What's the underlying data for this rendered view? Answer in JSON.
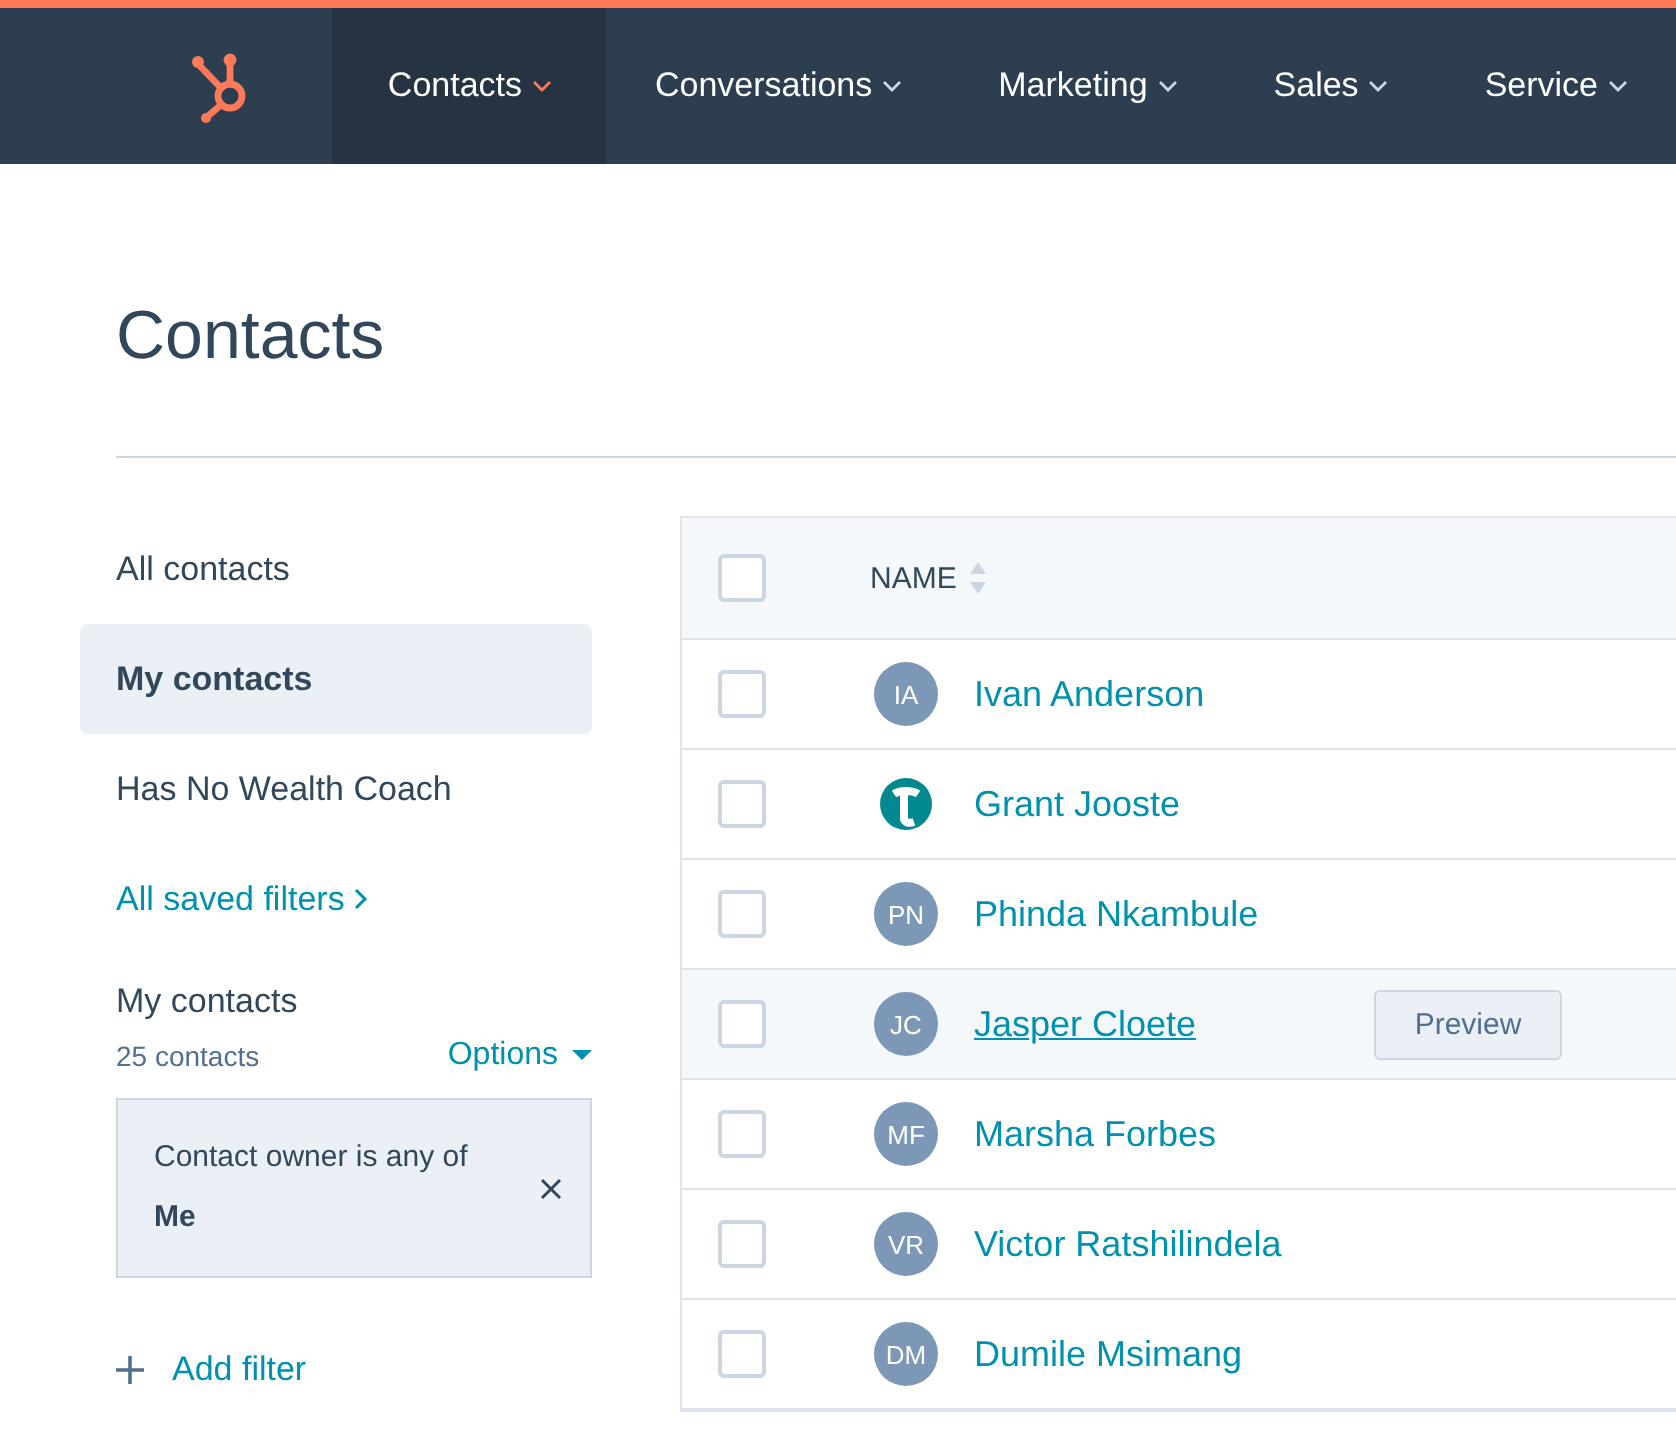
{
  "nav": {
    "items": [
      {
        "label": "Contacts",
        "selected": true
      },
      {
        "label": "Conversations",
        "selected": false
      },
      {
        "label": "Marketing",
        "selected": false
      },
      {
        "label": "Sales",
        "selected": false
      },
      {
        "label": "Service",
        "selected": false
      }
    ]
  },
  "page_title": "Contacts",
  "sidebar": {
    "views": [
      {
        "label": "All contacts",
        "selected": false
      },
      {
        "label": "My contacts",
        "selected": true
      },
      {
        "label": "Has No Wealth Coach",
        "selected": false
      }
    ],
    "saved_filters_link": "All saved filters",
    "current_view": {
      "title": "My contacts",
      "count": "25 contacts",
      "options": "Options",
      "filters": [
        {
          "text": "Contact owner is any of **Me**"
        }
      ]
    },
    "add_filter": "Add filter"
  },
  "table": {
    "all_checked": false,
    "columns": [
      "NAME"
    ],
    "rows": [
      {
        "name": "Ivan Anderson",
        "avatar": {
          "kind": "initials",
          "initials": "IA"
        },
        "checked": false,
        "hovered": false
      },
      {
        "name": "Grant Jooste",
        "avatar": {
          "kind": "logo"
        },
        "checked": false,
        "hovered": false
      },
      {
        "name": "Phinda Nkambule",
        "avatar": {
          "kind": "initials",
          "initials": "PN"
        },
        "checked": false,
        "hovered": false
      },
      {
        "name": "Jasper Cloete",
        "avatar": {
          "kind": "initials",
          "initials": "JC"
        },
        "checked": false,
        "hovered": true,
        "action": "Preview"
      },
      {
        "name": "Marsha Forbes",
        "avatar": {
          "kind": "initials",
          "initials": "MF"
        },
        "checked": false,
        "hovered": false
      },
      {
        "name": "Victor Ratshilindela",
        "avatar": {
          "kind": "initials",
          "initials": "VR"
        },
        "checked": false,
        "hovered": false
      },
      {
        "name": "Dumile Msimang",
        "avatar": {
          "kind": "initials",
          "initials": "DM"
        },
        "checked": false,
        "hovered": false
      }
    ]
  }
}
